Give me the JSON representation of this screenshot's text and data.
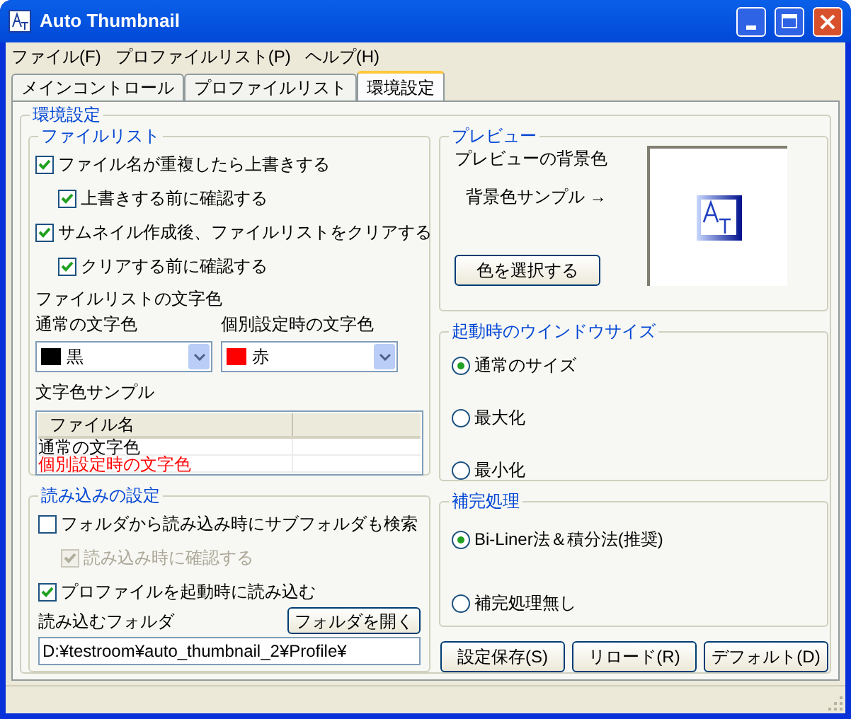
{
  "window": {
    "title": "Auto Thumbnail"
  },
  "menu": [
    "ファイル(F)",
    "プロファイルリスト(P)",
    "ヘルプ(H)"
  ],
  "tabs": [
    {
      "label": "メインコントロール",
      "selected": false
    },
    {
      "label": "プロファイルリスト",
      "selected": false
    },
    {
      "label": "環境設定",
      "selected": true
    }
  ],
  "settings": {
    "title": "環境設定",
    "file_list": {
      "title": "ファイルリスト",
      "checkboxes": [
        {
          "label": "ファイル名が重複したら上書きする",
          "checked": true,
          "disabled": false,
          "children": [
            {
              "label": "上書きする前に確認する",
              "checked": true,
              "disabled": false
            }
          ]
        },
        {
          "label": "サムネイル作成後、ファイルリストをクリアする",
          "checked": true,
          "disabled": false,
          "children": [
            {
              "label": "クリアする前に確認する",
              "checked": true,
              "disabled": false
            }
          ]
        }
      ],
      "color_heading": "ファイルリストの文字色",
      "color_selects": [
        {
          "label": "通常の文字色",
          "value": "黒",
          "color": "#000000"
        },
        {
          "label": "個別設定時の文字色",
          "value": "赤",
          "color": "#ff0000"
        }
      ],
      "sample": {
        "label": "文字色サンプル",
        "columns": [
          "ファイル名"
        ],
        "rows": [
          {
            "text": "通常の文字色",
            "color": "#000000"
          },
          {
            "text": "個別設定時の文字色",
            "color": "#ff0000"
          }
        ]
      }
    },
    "loading": {
      "title": "読み込みの設定",
      "checkboxes": [
        {
          "label": "フォルダから読み込み時にサブフォルダも検索",
          "checked": false,
          "disabled": false,
          "children": [
            {
              "label": "読み込み時に確認する",
              "checked": true,
              "disabled": true
            }
          ]
        },
        {
          "label": "プロファイルを起動時に読み込む",
          "checked": true,
          "disabled": false
        }
      ],
      "folder_label": "読み込むフォルダ",
      "open_button": "フォルダを開く",
      "folder_path": "D:¥testroom¥auto_thumbnail_2¥Profile¥"
    },
    "preview": {
      "title": "プレビュー",
      "background_label": "プレビューの背景色",
      "sample_label": "背景色サンプル →",
      "button": "色を選択する"
    },
    "window_size": {
      "title": "起動時のウインドウサイズ",
      "options": [
        {
          "label": "通常のサイズ",
          "selected": true
        },
        {
          "label": "最大化",
          "selected": false
        },
        {
          "label": "最小化",
          "selected": false
        }
      ]
    },
    "interpolation": {
      "title": "補完処理",
      "options": [
        {
          "label": "Bi-Liner法＆積分法(推奨)",
          "selected": true
        },
        {
          "label": "補完処理無し",
          "selected": false
        }
      ]
    },
    "buttons": [
      "設定保存(S)",
      "リロード(R)",
      "デフォルト(D)"
    ]
  }
}
